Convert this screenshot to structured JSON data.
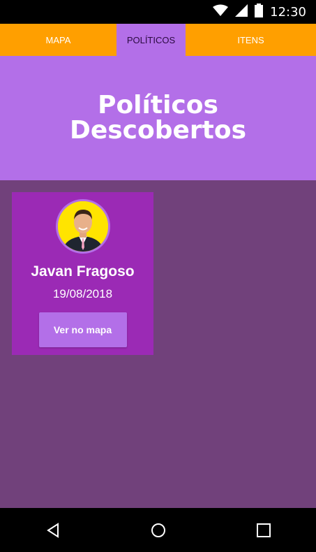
{
  "status_bar": {
    "time": "12:30",
    "icons": [
      "wifi-icon",
      "signal-icon",
      "battery-icon"
    ]
  },
  "tabs": [
    {
      "label": "MAPA",
      "active": false
    },
    {
      "label": "POLÍTICOS",
      "active": true
    },
    {
      "label": "ITENS",
      "active": false
    }
  ],
  "hero": {
    "title": "Políticos Descobertos"
  },
  "cards": [
    {
      "name": "Javan Fragoso",
      "date": "19/08/2018",
      "button_label": "Ver no mapa"
    }
  ],
  "nav_bar": {
    "icons": [
      "back-icon",
      "home-icon",
      "recents-icon"
    ]
  },
  "colors": {
    "tab_bar": "#ff9f00",
    "accent_purple": "#b36fe8",
    "content_bg": "#71417b",
    "card_bg": "#9b2ab5",
    "avatar_bg": "#ffe400"
  }
}
